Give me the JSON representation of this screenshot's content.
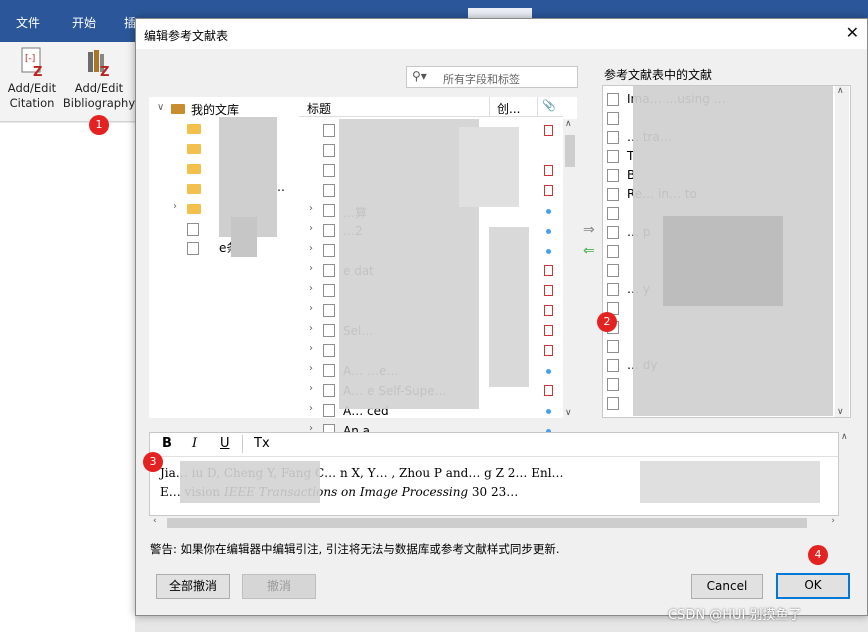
{
  "word": {
    "tabs": [
      "文件",
      "开始",
      "插"
    ],
    "buttons": [
      {
        "line1": "Add/Edit",
        "line2": "Citation",
        "icon": "citation-icon"
      },
      {
        "line1": "Add/Edit",
        "line2": "Bibliography",
        "icon": "bibliography-icon"
      }
    ]
  },
  "dialog": {
    "title": "编辑参考文献表",
    "close": "✕",
    "search_placeholder": "所有字段和标签",
    "library": {
      "root": "我的文库",
      "items": [
        "",
        "",
        "",
        "",
        "",
        "",
        ""
      ],
      "partial_texts": [
        "…",
        "e条目"
      ]
    },
    "columns": {
      "title": "标题",
      "creator": "创...",
      "attach": "📎"
    },
    "list_rows": [
      {
        "text": "",
        "attach": "pdf"
      },
      {
        "text": "",
        "attach": ""
      },
      {
        "text": "",
        "attach": "pdf"
      },
      {
        "text": "",
        "attach": "pdf"
      },
      {
        "text": "…算",
        "attach": "dot"
      },
      {
        "text": "…2",
        "attach": "dot"
      },
      {
        "text": "",
        "attach": "dot"
      },
      {
        "text": "e dat",
        "attach": "pdf"
      },
      {
        "text": "",
        "attach": "pdf"
      },
      {
        "text": "",
        "attach": "pdf"
      },
      {
        "text": "Sel…",
        "attach": "pdf"
      },
      {
        "text": "",
        "attach": "pdf"
      },
      {
        "text": "A…  …e…",
        "attach": "dot"
      },
      {
        "text": "A…  e Self-Supe...",
        "attach": "pdf"
      },
      {
        "text": "A…  ced",
        "attach": "dot"
      },
      {
        "text": "An a",
        "attach": "dot"
      }
    ],
    "right_header": "参考文献表中的文献",
    "right_rows": [
      "Ima…  …using …",
      "",
      "…  tra…",
      "T",
      "B",
      "Re…  in…  to",
      "",
      "…  p",
      "",
      "",
      "…  y",
      "",
      "",
      "",
      "…  dy",
      "",
      ""
    ],
    "format": {
      "bold": "B",
      "italic": "I",
      "underline": "U",
      "clear": "Tx"
    },
    "preview_line1": "Jia…  iu D, Cheng Y, Fang C…  n X, Y…  , Zhou P and…  g Z 2…  Enl…",
    "preview_line2_prefix": "E…  vision ",
    "preview_line2_italic": "IEEE Transactions on Image Processing",
    "preview_line2_suffix": " 30 23…",
    "warning": "警告: 如果你在编辑器中编辑引注, 引注将无法与数据库或参考文献样式同步更新.",
    "buttons": {
      "revert_all": "全部撤消",
      "revert": "撤消",
      "cancel": "Cancel",
      "ok": "OK"
    }
  },
  "badges": [
    "1",
    "2",
    "3",
    "4"
  ],
  "watermark": "CSDN @HUI 别摸鱼了"
}
